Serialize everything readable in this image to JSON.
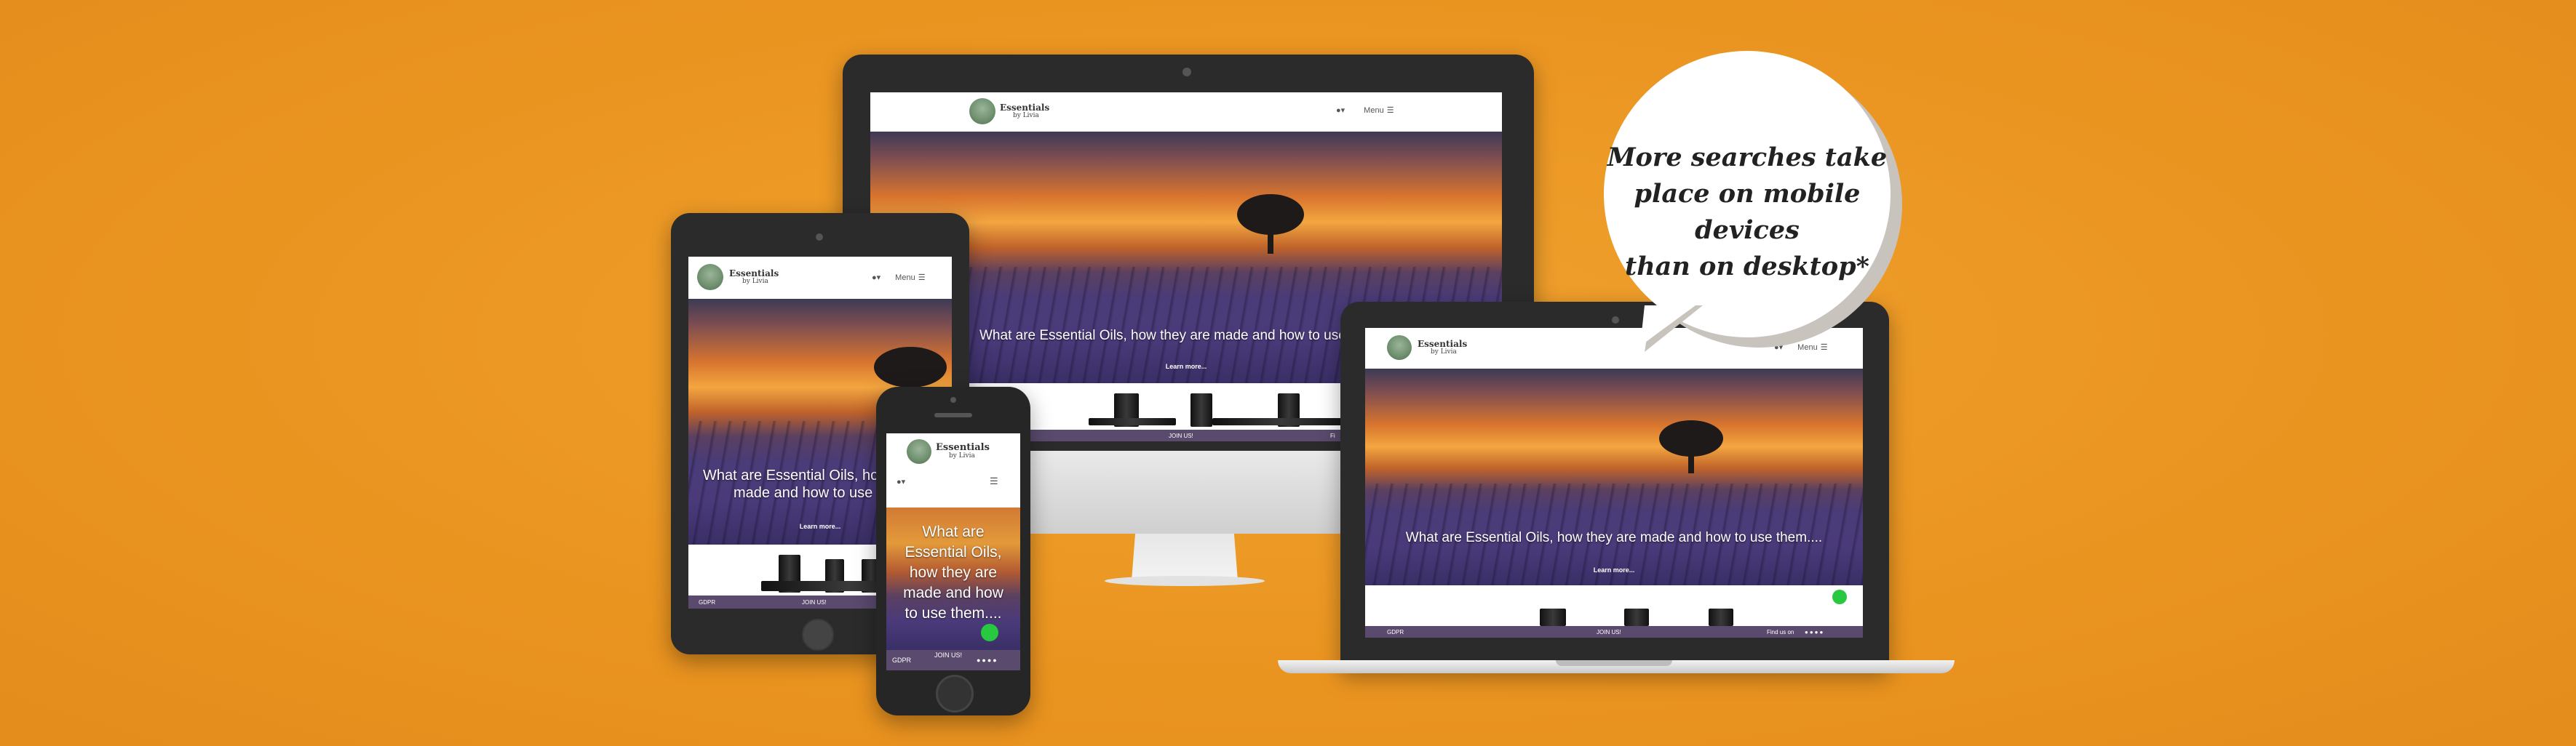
{
  "site": {
    "brand_name": "Essentials",
    "brand_sub": "by Livia",
    "menu_label": "Menu",
    "hero_text": "What are Essential Oils, how they are made and how to use them....",
    "hero_text_truncated_desktop": "What are Essential Oils, how they are made and how to use",
    "hero_text_tablet_line1": "What are Essential Oils, how",
    "hero_text_tablet_line2": "made and how to use th",
    "hero_text_phone": "What are Essential Oils, how they are made and how to use them....",
    "learn_more": "Learn more...",
    "footer_gdpr": "GDPR",
    "footer_join": "JOIN US!",
    "footer_find": "Find us on",
    "footer_find_short": "Fi"
  },
  "callout": {
    "line1": "More searches take",
    "line2": "place on mobile devices",
    "line3": "than on desktop*"
  },
  "colors": {
    "background": "#EA9420",
    "device": "#2b2b2b",
    "footer": "#5a4a6e",
    "whatsapp": "#28c840"
  },
  "icons": [
    "user-icon",
    "hamburger-icon",
    "whatsapp-icon",
    "social-icons",
    "camera-icon",
    "home-button-icon"
  ]
}
